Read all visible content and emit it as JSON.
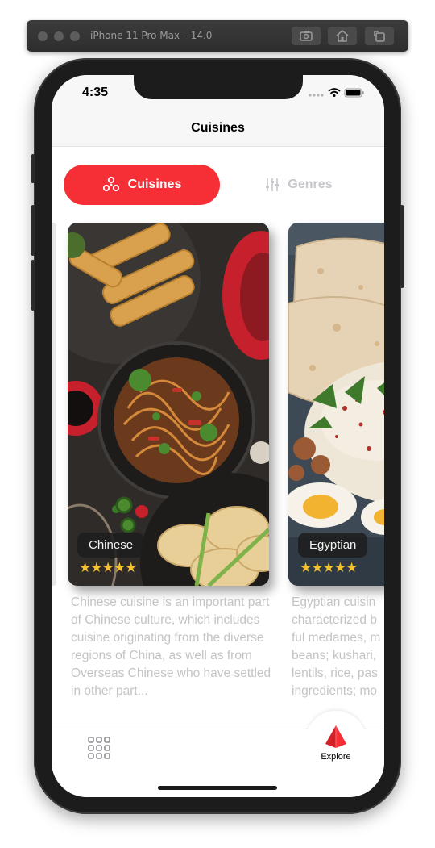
{
  "simulator": {
    "title": "iPhone 11 Pro Max – 14.0",
    "buttons": [
      "screenshot-icon",
      "home-icon",
      "rotate-icon"
    ]
  },
  "status_bar": {
    "time": "4:35"
  },
  "nav": {
    "title": "Cuisines"
  },
  "tabs": [
    {
      "label": "Cuisines",
      "icon": "cuisines-icon",
      "active": true
    },
    {
      "label": "Genres",
      "icon": "sliders-icon",
      "active": false
    }
  ],
  "cards": [
    {
      "name": "Chinese",
      "stars": "★★★★★",
      "description": "Chinese cuisine is an important part of Chinese culture, which includes cuisine originating from the diverse regions of China, as well as from Overseas Chinese who have settled in other part..."
    },
    {
      "name": "Egyptian",
      "stars": "★★★★★",
      "description": "Egyptian cuisin characterized b ful medames, m beans; kushari, lentils, rice, pas ingredients; mo"
    }
  ],
  "tabbar": {
    "items": [
      {
        "label": "",
        "icon": "grid-icon"
      },
      {
        "label": "Explore",
        "icon": "explore-icon"
      }
    ]
  },
  "colors": {
    "accent": "#f62f36",
    "star": "#f5c231",
    "muted": "#c4c4c4"
  }
}
